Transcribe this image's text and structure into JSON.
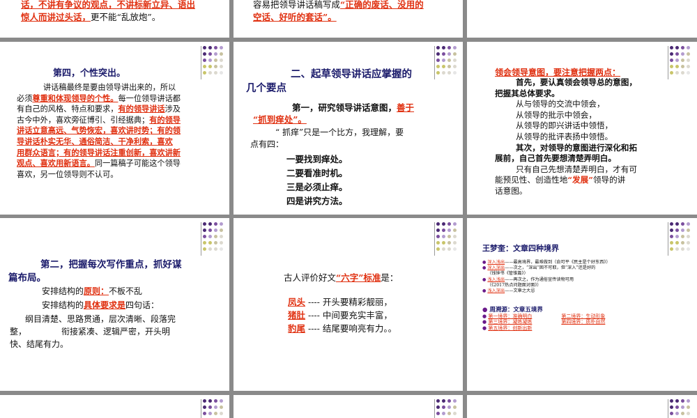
{
  "slide1": {
    "line1": "话，不讲有争议的观点，不讲标新立异、语出",
    "line2a": "惊人而讲过头话，",
    "line2b": "更不能“乱放炮”。"
  },
  "slide2": {
    "line1a": "容易把领导讲话稿写成",
    "line1b": "“正确的废话、没用的",
    "line2": "空话、好听的套话”。"
  },
  "slide4": {
    "heading": "第四，个性突出。",
    "l1": "讲话稿最终是要由领导讲出来的，所以",
    "l2a": "必须",
    "l2b": "尊重和体现领导的个性。",
    "l2c": "每一位领导讲话都",
    "l3a": "有自己的风格、特点和要求，",
    "l3b": "有的领导讲话",
    "l3c": "涉及",
    "l4a": "古今中外，喜欢旁征博引、引经据典；",
    "l4b": "有的领导",
    "l5": "讲话立意高远、气势恢宏，喜欢讲时势；有的领",
    "l6a": "导讲话",
    "l6b": "朴实无华、通俗简洁、干净利索，喜欢",
    "l7": "用群众语言；有的领导讲话注重创新，喜欢讲新",
    "l8a": "观点、喜欢用新语言。",
    "l8b": "同一篇稿子可能这个领导",
    "l9": "喜欢，另一位领导则不认可。"
  },
  "slide5": {
    "heading1": "二、起草领导讲话应掌握的",
    "heading2": "几个要点",
    "sub1a": "第一，研究领导讲话意图，",
    "sub1b": "善于",
    "sub2": "“抓到痒处”。",
    "p1": "“ 抓痒”只是一个比方，我理解，要",
    "p2": "点有四：",
    "items": [
      "一要找到痒处。",
      "二要看准时机。",
      "三是必须止痒。",
      "四是讲究方法。"
    ]
  },
  "slide6": {
    "heading": "领会领导意图，要注意把握两点：",
    "l1": "首先，要认真领会领导总的意图，",
    "l2": "把握其总体要求。",
    "l3": "从与领导的交流中领会，",
    "l4": "从领导的批示中领会，",
    "l5": "从领导的即兴讲话中领悟，",
    "l6": "从领导的批评表扬中领悟。",
    "l7": "其次，对领导的意图进行深化和拓",
    "l8": "展前，自己首先要想清楚弄明白。",
    "l9": "只有自己先想清楚弄明白，才有可",
    "l10a": "能预见性、创造性地",
    "l10b": "“发展”",
    "l10c": "领导的讲",
    "l11": "话意图。"
  },
  "slide7": {
    "heading1": "第二，把握每次写作重点，抓好谋",
    "heading2": "篇布局。",
    "p1a": "安排结构的",
    "p1b": "原则：",
    "p1c": "不板不乱",
    "p2a": "安排结构的",
    "p2b": "具体要求是",
    "p2c": "四句话：",
    "p3": "纲目清楚、思路贯通，层次清晰、段落完",
    "p4a": "整，",
    "p4b": "衔接紧凑、逻辑严密，开头明",
    "p5": "快、结尾有力。"
  },
  "slide8": {
    "intro_a": "古人评价好文",
    "intro_b": "“六字”标准",
    "intro_c": "是：",
    "rows": [
      {
        "k": "凤头",
        "v": " ---- 开头要精彩靓丽，"
      },
      {
        "k": "猪肚",
        "v": " ---- 中间要充实丰富，"
      },
      {
        "k": "豹尾",
        "v": " ---- 结尾要响亮有力。。"
      }
    ]
  },
  "slide9": {
    "title1": "王梦奎：文章四种境界",
    "b1a": "深入浅出",
    "b1b": "——最高境界，最难做到（俞可平《民主是个好东西》）",
    "b2a": "深入深出",
    "b2b": "——次之，“深出”固不可取，但“深入”还是好的",
    "b2c": "（钱钟书《管锥篇》）",
    "b3a": "浅入浅出",
    "b3b": "——再次之，作为通俗宣传读物可用",
    "b3c": "（《2017热点问题面对面》）",
    "b4a": "浅入深出",
    "b4b": "——文章之大忌",
    "title2": "周溯源：文章五境界",
    "c1": "第一境界：准确明白",
    "c2": "第二境界：生动形象",
    "c3": "第三境界：凝练凝练",
    "c4": "第四境界：质朴自然",
    "c5": "第五境界：创新出新"
  }
}
